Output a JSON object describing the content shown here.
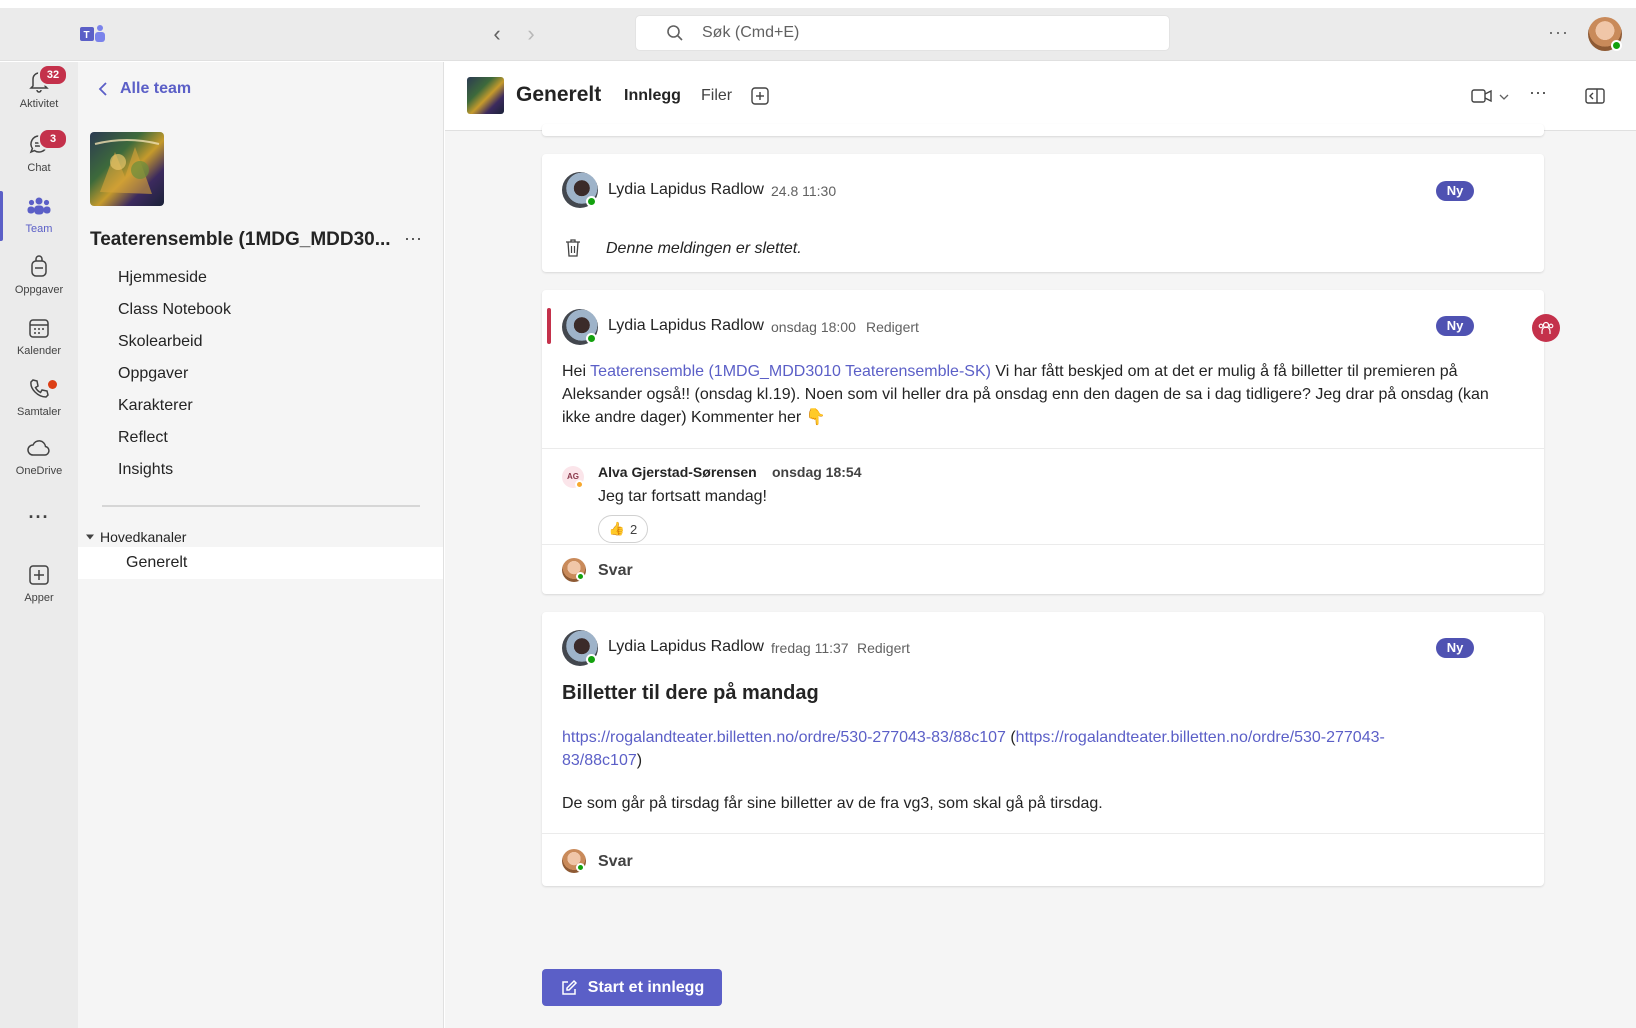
{
  "titlebar": {
    "search_placeholder": "Søk (Cmd+E)",
    "more_label": "···"
  },
  "rail": {
    "items": [
      {
        "label": "Aktivitet",
        "badge": "32"
      },
      {
        "label": "Chat",
        "badge": "3"
      },
      {
        "label": "Team"
      },
      {
        "label": "Oppgaver"
      },
      {
        "label": "Kalender"
      },
      {
        "label": "Samtaler"
      },
      {
        "label": "OneDrive"
      },
      {
        "label": "Apper"
      }
    ],
    "more_label": "···"
  },
  "teampanel": {
    "back_label": "Alle team",
    "team_name": "Teaterensemble (1MDG_MDD30...",
    "more_label": "···",
    "links": [
      "Hjemmeside",
      "Class Notebook",
      "Skolearbeid",
      "Oppgaver",
      "Karakterer",
      "Reflect",
      "Insights"
    ],
    "section_label": "Hovedkanaler",
    "channel": "Generelt"
  },
  "header": {
    "channel_title": "Generelt",
    "tabs": [
      "Innlegg",
      "Filer"
    ],
    "more_label": "···"
  },
  "posts": [
    {
      "author": "Lydia Lapidus Radlow",
      "time": "24.8 11:30",
      "badge": "Ny",
      "deleted_text": "Denne meldingen er slettet."
    },
    {
      "author": "Lydia Lapidus Radlow",
      "time": "onsdag 18:00",
      "edited": "Redigert",
      "badge": "Ny",
      "body_prefix": "Hei ",
      "mention": "Teaterensemble (1MDG_MDD3010 Teaterensemble-SK)",
      "body_suffix": " Vi har fått beskjed om at det er mulig å få billetter til premieren på Aleksander også!! (onsdag kl.19). Noen som vil heller dra på onsdag enn den dagen de sa i dag tidligere? Jeg drar på onsdag (kan ikke andre dager) Kommenter her",
      "emoji": "👇",
      "reply": {
        "initials": "AG",
        "author": "Alva Gjerstad-Sørensen",
        "time": "onsdag 18:54",
        "text": "Jeg tar fortsatt mandag!",
        "reaction_emoji": "👍",
        "reaction_count": "2"
      },
      "reply_label": "Svar"
    },
    {
      "author": "Lydia Lapidus Radlow",
      "time": "fredag 11:37",
      "edited": "Redigert",
      "badge": "Ny",
      "subject": "Billetter til dere på mandag",
      "link1": "https://rogalandteater.billetten.no/ordre/530-277043-83/88c107",
      "link2": "https://rogalandteater.billetten.no/ordre/530-277043-83/88c107",
      "paragraph": "De som går på tirsdag får sine billetter av de fra vg3, som skal gå på tirsdag.",
      "reply_label": "Svar"
    }
  ],
  "start_post_label": "Start et innlegg",
  "colors": {
    "accent": "#5b5fc7",
    "badge": "#c4314b",
    "ny_badge": "#4f52b2",
    "presence": "#13a10e"
  }
}
